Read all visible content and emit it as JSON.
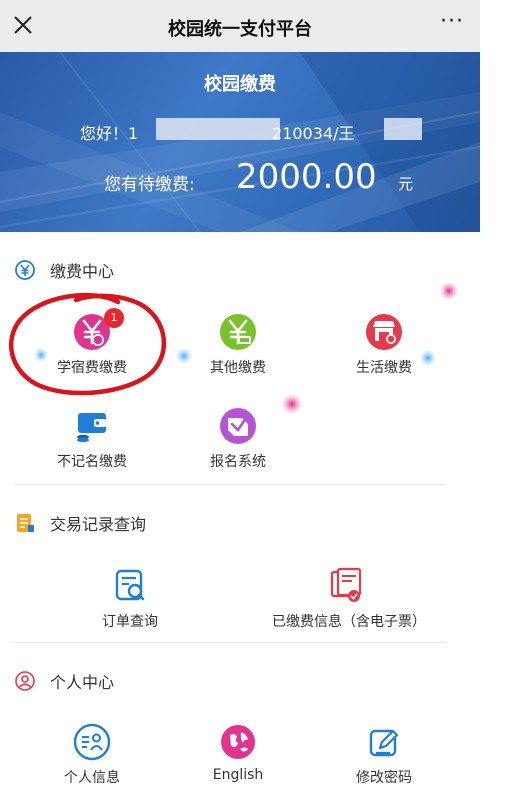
{
  "header": {
    "title": "校园统一支付平台",
    "more_label": "···"
  },
  "banner": {
    "title": "校园缴费",
    "greeting": "您好！1",
    "id_suffix": "210034/王",
    "due_label": "您有待缴费:",
    "due_amount": "2000.00",
    "due_unit": "元"
  },
  "payment_center": {
    "title": "缴费中心",
    "items": [
      {
        "label": "学宿费缴费",
        "badge": "1"
      },
      {
        "label": "其他缴费"
      },
      {
        "label": "生活缴费"
      },
      {
        "label": "不记名缴费"
      },
      {
        "label": "报名系统"
      }
    ]
  },
  "records": {
    "title": "交易记录查询",
    "items": [
      {
        "label": "订单查询"
      },
      {
        "label": "已缴费信息（含电子票）"
      }
    ]
  },
  "personal": {
    "title": "个人中心",
    "items": [
      {
        "label": "个人信息"
      },
      {
        "label": "English"
      },
      {
        "label": "修改密码"
      }
    ]
  },
  "colors": {
    "banner_blue": "#2f69b8",
    "pink": "#e2338f",
    "green": "#78c22b",
    "red": "#e8394a",
    "blue": "#1e7fd8",
    "purple": "#b655d4",
    "annotation_red": "#d9141b"
  }
}
